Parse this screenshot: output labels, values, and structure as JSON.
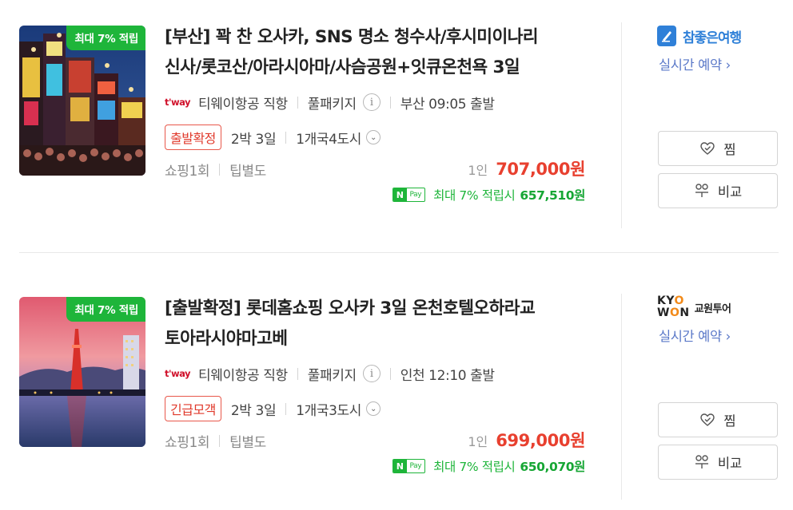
{
  "products": [
    {
      "badge": "최대 7% 적립",
      "title_line1": "[부산] 꽉 찬 오사카, SNS 명소 청수사/후시미이나리",
      "title_line2": "신사/롯코산/아라시아마/사슴공원+잇큐온천욕 3일",
      "airline_logo": "t'way",
      "airline": "티웨이항공 직항",
      "package_type": "풀패키지",
      "departure": "부산 09:05 출발",
      "status_tag": "출발확정",
      "duration": "2박 3일",
      "cities": "1개국4도시",
      "shopping": "쇼핑1회",
      "tip": "팁별도",
      "price_unit": "1인",
      "price": "707,000원",
      "npay_n": "N",
      "npay_pay": "Pay",
      "npay_text": "최대 7% 적립시",
      "npay_price": "657,510원",
      "vendor_name": "참좋은여행",
      "vendor_link": "실시간 예약 ›",
      "wish_label": "찜",
      "compare_label": "비교"
    },
    {
      "badge": "최대 7% 적립",
      "title_line1": "[출발확정] 롯데홈쇼핑 오사카 3일 온천호텔오하라교",
      "title_line2": "토아라시야마고베",
      "airline_logo": "t'way",
      "airline": "티웨이항공 직항",
      "package_type": "풀패키지",
      "departure": "인천 12:10 출발",
      "status_tag": "긴급모객",
      "duration": "2박 3일",
      "cities": "1개국3도시",
      "shopping": "쇼핑1회",
      "tip": "팁별도",
      "price_unit": "1인",
      "price": "699,000원",
      "npay_n": "N",
      "npay_pay": "Pay",
      "npay_text": "최대 7% 적립시",
      "npay_price": "650,070원",
      "vendor_name_line1_a": "KY",
      "vendor_name_line1_b": "O",
      "vendor_name_line2_a": "W",
      "vendor_name_line2_b": "O",
      "vendor_name_line2_c": "N",
      "vendor_name_ko": "교원투어",
      "vendor_link": "실시간 예약 ›",
      "wish_label": "찜",
      "compare_label": "비교"
    }
  ],
  "colors": {
    "green": "#1eb53a",
    "price_red": "#e8402f",
    "tag_red": "#e0392b",
    "link_blue": "#5a78c8"
  },
  "icons": {
    "info": "i",
    "chevron": "⌄"
  }
}
